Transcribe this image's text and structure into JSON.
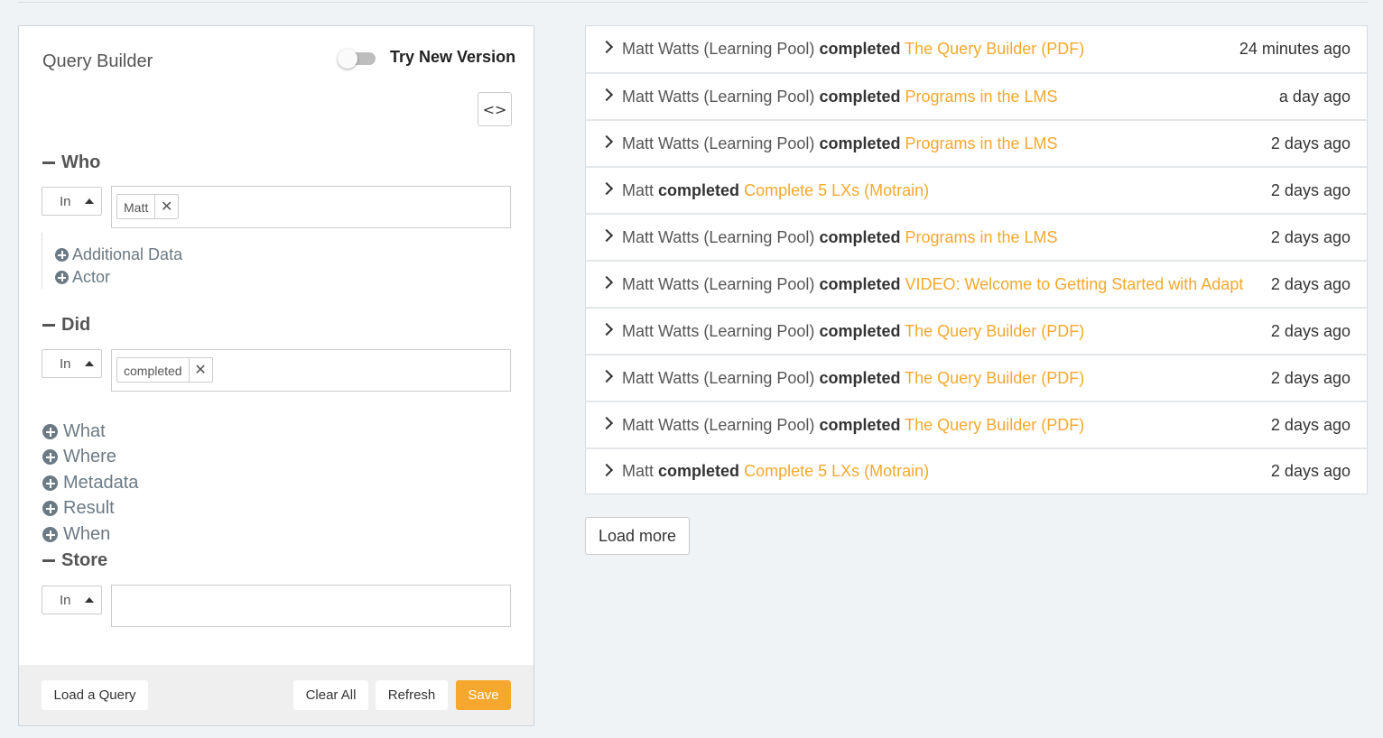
{
  "query_builder": {
    "title": "Query Builder",
    "toggle_label": "Try New Version",
    "toggle_on": false,
    "code_button_glyph": "<>",
    "who": {
      "heading": "Who",
      "operator": "In",
      "tags": [
        "Matt"
      ],
      "sub_items": [
        "Additional Data",
        "Actor"
      ]
    },
    "did": {
      "heading": "Did",
      "operator": "In",
      "tags": [
        "completed"
      ]
    },
    "collapsed_sections": [
      "What",
      "Where",
      "Metadata",
      "Result",
      "When"
    ],
    "store": {
      "heading": "Store",
      "operator": "In",
      "tags": []
    },
    "footer": {
      "load_query": "Load a Query",
      "clear_all": "Clear All",
      "refresh": "Refresh",
      "save": "Save"
    }
  },
  "feed": {
    "rows": [
      {
        "actor": "Matt Watts (Learning Pool)",
        "verb": "completed",
        "object": "The Query Builder (PDF)",
        "time": "24 minutes ago"
      },
      {
        "actor": "Matt Watts (Learning Pool)",
        "verb": "completed",
        "object": "Programs in the LMS",
        "time": "a day ago"
      },
      {
        "actor": "Matt Watts (Learning Pool)",
        "verb": "completed",
        "object": "Programs in the LMS",
        "time": "2 days ago"
      },
      {
        "actor": "Matt",
        "verb": "completed",
        "object": "Complete 5 LXs (Motrain)",
        "time": "2 days ago"
      },
      {
        "actor": "Matt Watts (Learning Pool)",
        "verb": "completed",
        "object": "Programs in the LMS",
        "time": "2 days ago"
      },
      {
        "actor": "Matt Watts (Learning Pool)",
        "verb": "completed",
        "object": "VIDEO: Welcome to Getting Started with Adapt",
        "time": "2 days ago"
      },
      {
        "actor": "Matt Watts (Learning Pool)",
        "verb": "completed",
        "object": "The Query Builder (PDF)",
        "time": "2 days ago"
      },
      {
        "actor": "Matt Watts (Learning Pool)",
        "verb": "completed",
        "object": "The Query Builder (PDF)",
        "time": "2 days ago"
      },
      {
        "actor": "Matt Watts (Learning Pool)",
        "verb": "completed",
        "object": "The Query Builder (PDF)",
        "time": "2 days ago"
      },
      {
        "actor": "Matt",
        "verb": "completed",
        "object": "Complete 5 LXs (Motrain)",
        "time": "2 days ago"
      }
    ],
    "load_more": "Load more"
  },
  "colors": {
    "accent": "#f5a82d",
    "panel_bg": "#ffffff",
    "page_bg": "#f0f3f6",
    "muted_icon": "#6b7a85"
  }
}
